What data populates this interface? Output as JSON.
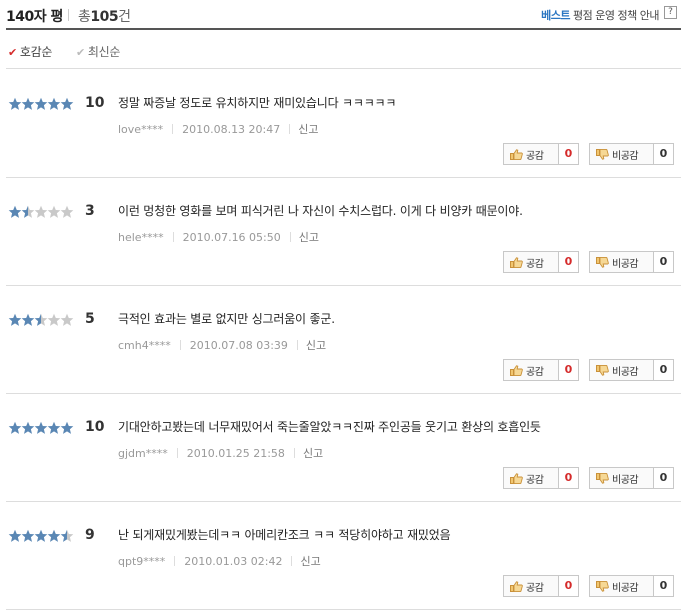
{
  "header": {
    "title": "140자 평",
    "total_prefix": "총",
    "total_count": "105",
    "total_suffix": "건",
    "best_label": "베스트",
    "policy_label": "평점 운영 정책 안내",
    "help_label": "?"
  },
  "sort": {
    "options": [
      {
        "label": "호감순",
        "active": true
      },
      {
        "label": "최신순",
        "active": false
      }
    ]
  },
  "reviews": [
    {
      "score_value": 10,
      "score": "10",
      "text": "정말 짜증날 정도로 유치하지만 재미있습니다 ㅋㅋㅋㅋㅋ",
      "user": "love****",
      "date": "2010.08.13 20:47",
      "report": "신고",
      "like_label": "공감",
      "like_count": "0",
      "dislike_label": "비공감",
      "dislike_count": "0"
    },
    {
      "score_value": 3,
      "score": "3",
      "text": "이런 멍청한 영화를 보며 피식거린 나 자신이 수치스럽다. 이게 다 비양카 때문이야.",
      "user": "hele****",
      "date": "2010.07.16 05:50",
      "report": "신고",
      "like_label": "공감",
      "like_count": "0",
      "dislike_label": "비공감",
      "dislike_count": "0"
    },
    {
      "score_value": 5,
      "score": "5",
      "text": "극적인 효과는 별로 없지만 싱그러움이 좋군.",
      "user": "cmh4****",
      "date": "2010.07.08 03:39",
      "report": "신고",
      "like_label": "공감",
      "like_count": "0",
      "dislike_label": "비공감",
      "dislike_count": "0"
    },
    {
      "score_value": 10,
      "score": "10",
      "text": "기대안하고봤는데 너무재밌어서 죽는줄알았ㅋㅋ진짜 주인공들 웃기고 환상의 호흡인듯",
      "user": "gjdm****",
      "date": "2010.01.25 21:58",
      "report": "신고",
      "like_label": "공감",
      "like_count": "0",
      "dislike_label": "비공감",
      "dislike_count": "0"
    },
    {
      "score_value": 9,
      "score": "9",
      "text": "난 되게재밌게봤는데ㅋㅋ 아메리칸조크 ㅋㅋ 적당히야하고 재밌었음",
      "user": "qpt9****",
      "date": "2010.01.03 02:42",
      "report": "신고",
      "like_label": "공감",
      "like_count": "0",
      "dislike_label": "비공감",
      "dislike_count": "0"
    }
  ],
  "colors": {
    "star_filled": "#5a87b4",
    "star_empty": "#c9c9c9",
    "like_count": "#d52b2b",
    "accent": "#2a76c2"
  },
  "icons": {
    "like": "thumbs-up-icon",
    "dislike": "thumbs-down-icon",
    "star": "star-icon",
    "check": "check-icon"
  }
}
